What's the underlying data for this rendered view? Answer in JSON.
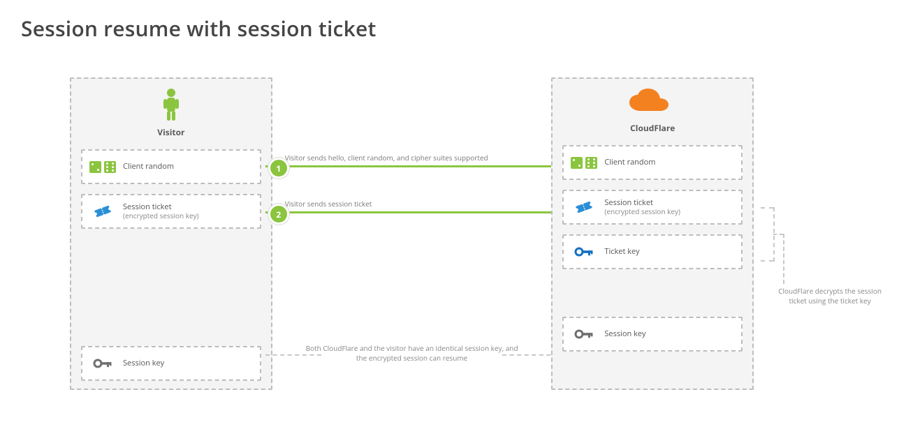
{
  "title": "Session resume with session ticket",
  "visitor": {
    "label": "Visitor",
    "cards": [
      {
        "title": "Client random"
      },
      {
        "title": "Session ticket",
        "subtitle": "(encrypted session key)"
      },
      {
        "title": "Session key"
      }
    ]
  },
  "cloudflare": {
    "label": "CloudFlare",
    "cards": [
      {
        "title": "Client random"
      },
      {
        "title": "Session ticket",
        "subtitle": "(encrypted session key)"
      },
      {
        "title": "Ticket key"
      },
      {
        "title": "Session key"
      }
    ]
  },
  "arrows": [
    {
      "num": "1",
      "label": "Visitor sends hello, client random, and cipher suites supported"
    },
    {
      "num": "2",
      "label": "Visitor sends session ticket"
    }
  ],
  "notes": {
    "mid": "Both CloudFlare and the visitor have an identical session key, and the encrypted session can resume",
    "right": "CloudFlare decrypts the session ticket using the ticket key"
  }
}
